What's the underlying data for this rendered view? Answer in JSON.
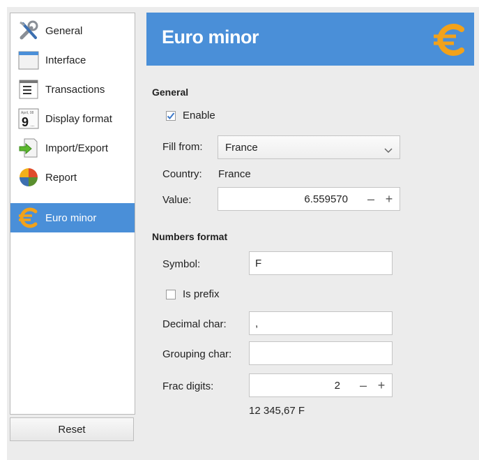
{
  "sidebar": {
    "items": [
      {
        "label": "General",
        "icon": "tools-icon"
      },
      {
        "label": "Interface",
        "icon": "window-icon"
      },
      {
        "label": "Transactions",
        "icon": "list-icon"
      },
      {
        "label": "Display format",
        "icon": "calendar-icon"
      },
      {
        "label": "Import/Export",
        "icon": "import-export-icon"
      },
      {
        "label": "Report",
        "icon": "pie-chart-icon"
      },
      {
        "label": "Euro minor",
        "icon": "euro-icon"
      }
    ],
    "active_index": 6,
    "reset_label": "Reset"
  },
  "header": {
    "title": "Euro minor",
    "icon": "euro-icon"
  },
  "general": {
    "section_title": "General",
    "enable_label": "Enable",
    "enable_checked": true,
    "fill_from_label": "Fill from:",
    "fill_from_value": "France",
    "country_label": "Country:",
    "country_value": "France",
    "value_label": "Value:",
    "value_value": "6.559570"
  },
  "numbers_format": {
    "section_title": "Numbers format",
    "symbol_label": "Symbol:",
    "symbol_value": "F",
    "is_prefix_label": "Is prefix",
    "is_prefix_checked": false,
    "decimal_char_label": "Decimal char:",
    "decimal_char_value": ",",
    "grouping_char_label": "Grouping char:",
    "grouping_char_value": "",
    "frac_digits_label": "Frac digits:",
    "frac_digits_value": "2",
    "preview": "12 345,67 F"
  },
  "colors": {
    "accent": "#4a8fd8",
    "euro_gold": "#f2a21b"
  }
}
